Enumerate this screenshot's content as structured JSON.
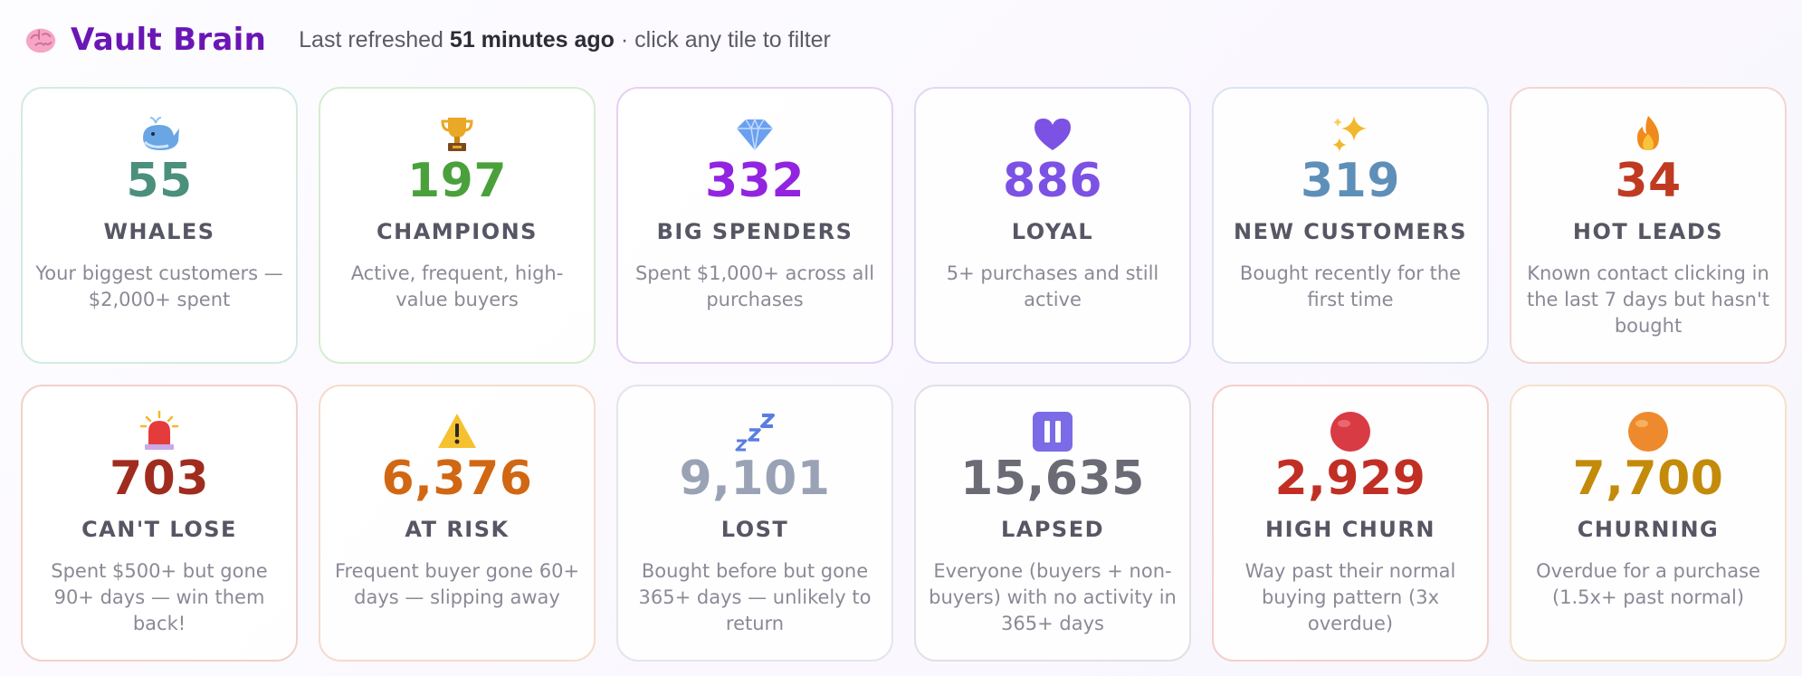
{
  "header": {
    "title": "Vault Brain",
    "refresh_prefix": "Last refreshed",
    "refresh_time": "51 minutes ago",
    "refresh_suffix": "· click any tile to filter",
    "icon": "brain-icon"
  },
  "tiles": [
    {
      "icon": "whale-icon",
      "count": "55",
      "label": "WHALES",
      "desc": "Your biggest customers — $2,000+ spent",
      "color": "#4b8f7d",
      "border": "#d3ebdf"
    },
    {
      "icon": "trophy-icon",
      "count": "197",
      "label": "CHAMPIONS",
      "desc": "Active, frequent, high-value buyers",
      "color": "#4aa13c",
      "border": "#d6edd0"
    },
    {
      "icon": "diamond-icon",
      "count": "332",
      "label": "BIG SPENDERS",
      "desc": "Spent $1,000+ across all purchases",
      "color": "#9224e0",
      "border": "#e6d1f4"
    },
    {
      "icon": "heart-icon",
      "count": "886",
      "label": "LOYAL",
      "desc": "5+ purchases and still active",
      "color": "#7b52e4",
      "border": "#e1d8f5"
    },
    {
      "icon": "sparkles-icon",
      "count": "319",
      "label": "NEW CUSTOMERS",
      "desc": "Bought recently for the first time",
      "color": "#5e8fb8",
      "border": "#dbe4f1"
    },
    {
      "icon": "fire-icon",
      "count": "34",
      "label": "HOT LEADS",
      "desc": "Known contact clicking in the last 7 days but hasn't bought",
      "color": "#c03a22",
      "border": "#f4d6d0"
    },
    {
      "icon": "siren-icon",
      "count": "703",
      "label": "CAN'T LOSE",
      "desc": "Spent $500+ but gone 90+ days — win them back!",
      "color": "#a02c1f",
      "border": "#f1d1cb"
    },
    {
      "icon": "warning-icon",
      "count": "6,376",
      "label": "AT RISK",
      "desc": "Frequent buyer gone 60+ days — slipping away",
      "color": "#d16712",
      "border": "#f6dccb"
    },
    {
      "icon": "zzz-icon",
      "count": "9,101",
      "label": "LOST",
      "desc": "Bought before but gone 365+ days — unlikely to return",
      "color": "#9aa2b5",
      "border": "#e3e5ec"
    },
    {
      "icon": "pause-icon",
      "count": "15,635",
      "label": "LAPSED",
      "desc": "Everyone (buyers + non-buyers) with no activity in 365+ days",
      "color": "#6b6b76",
      "border": "#e0e0e6"
    },
    {
      "icon": "red-circle-icon",
      "count": "2,929",
      "label": "HIGH CHURN",
      "desc": "Way past their normal buying pattern (3x overdue)",
      "color": "#c12f24",
      "border": "#f4cfcb"
    },
    {
      "icon": "orange-circle-icon",
      "count": "7,700",
      "label": "CHURNING",
      "desc": "Overdue for a purchase (1.5x+ past normal)",
      "color": "#c48a0a",
      "border": "#f4e2c8"
    }
  ]
}
